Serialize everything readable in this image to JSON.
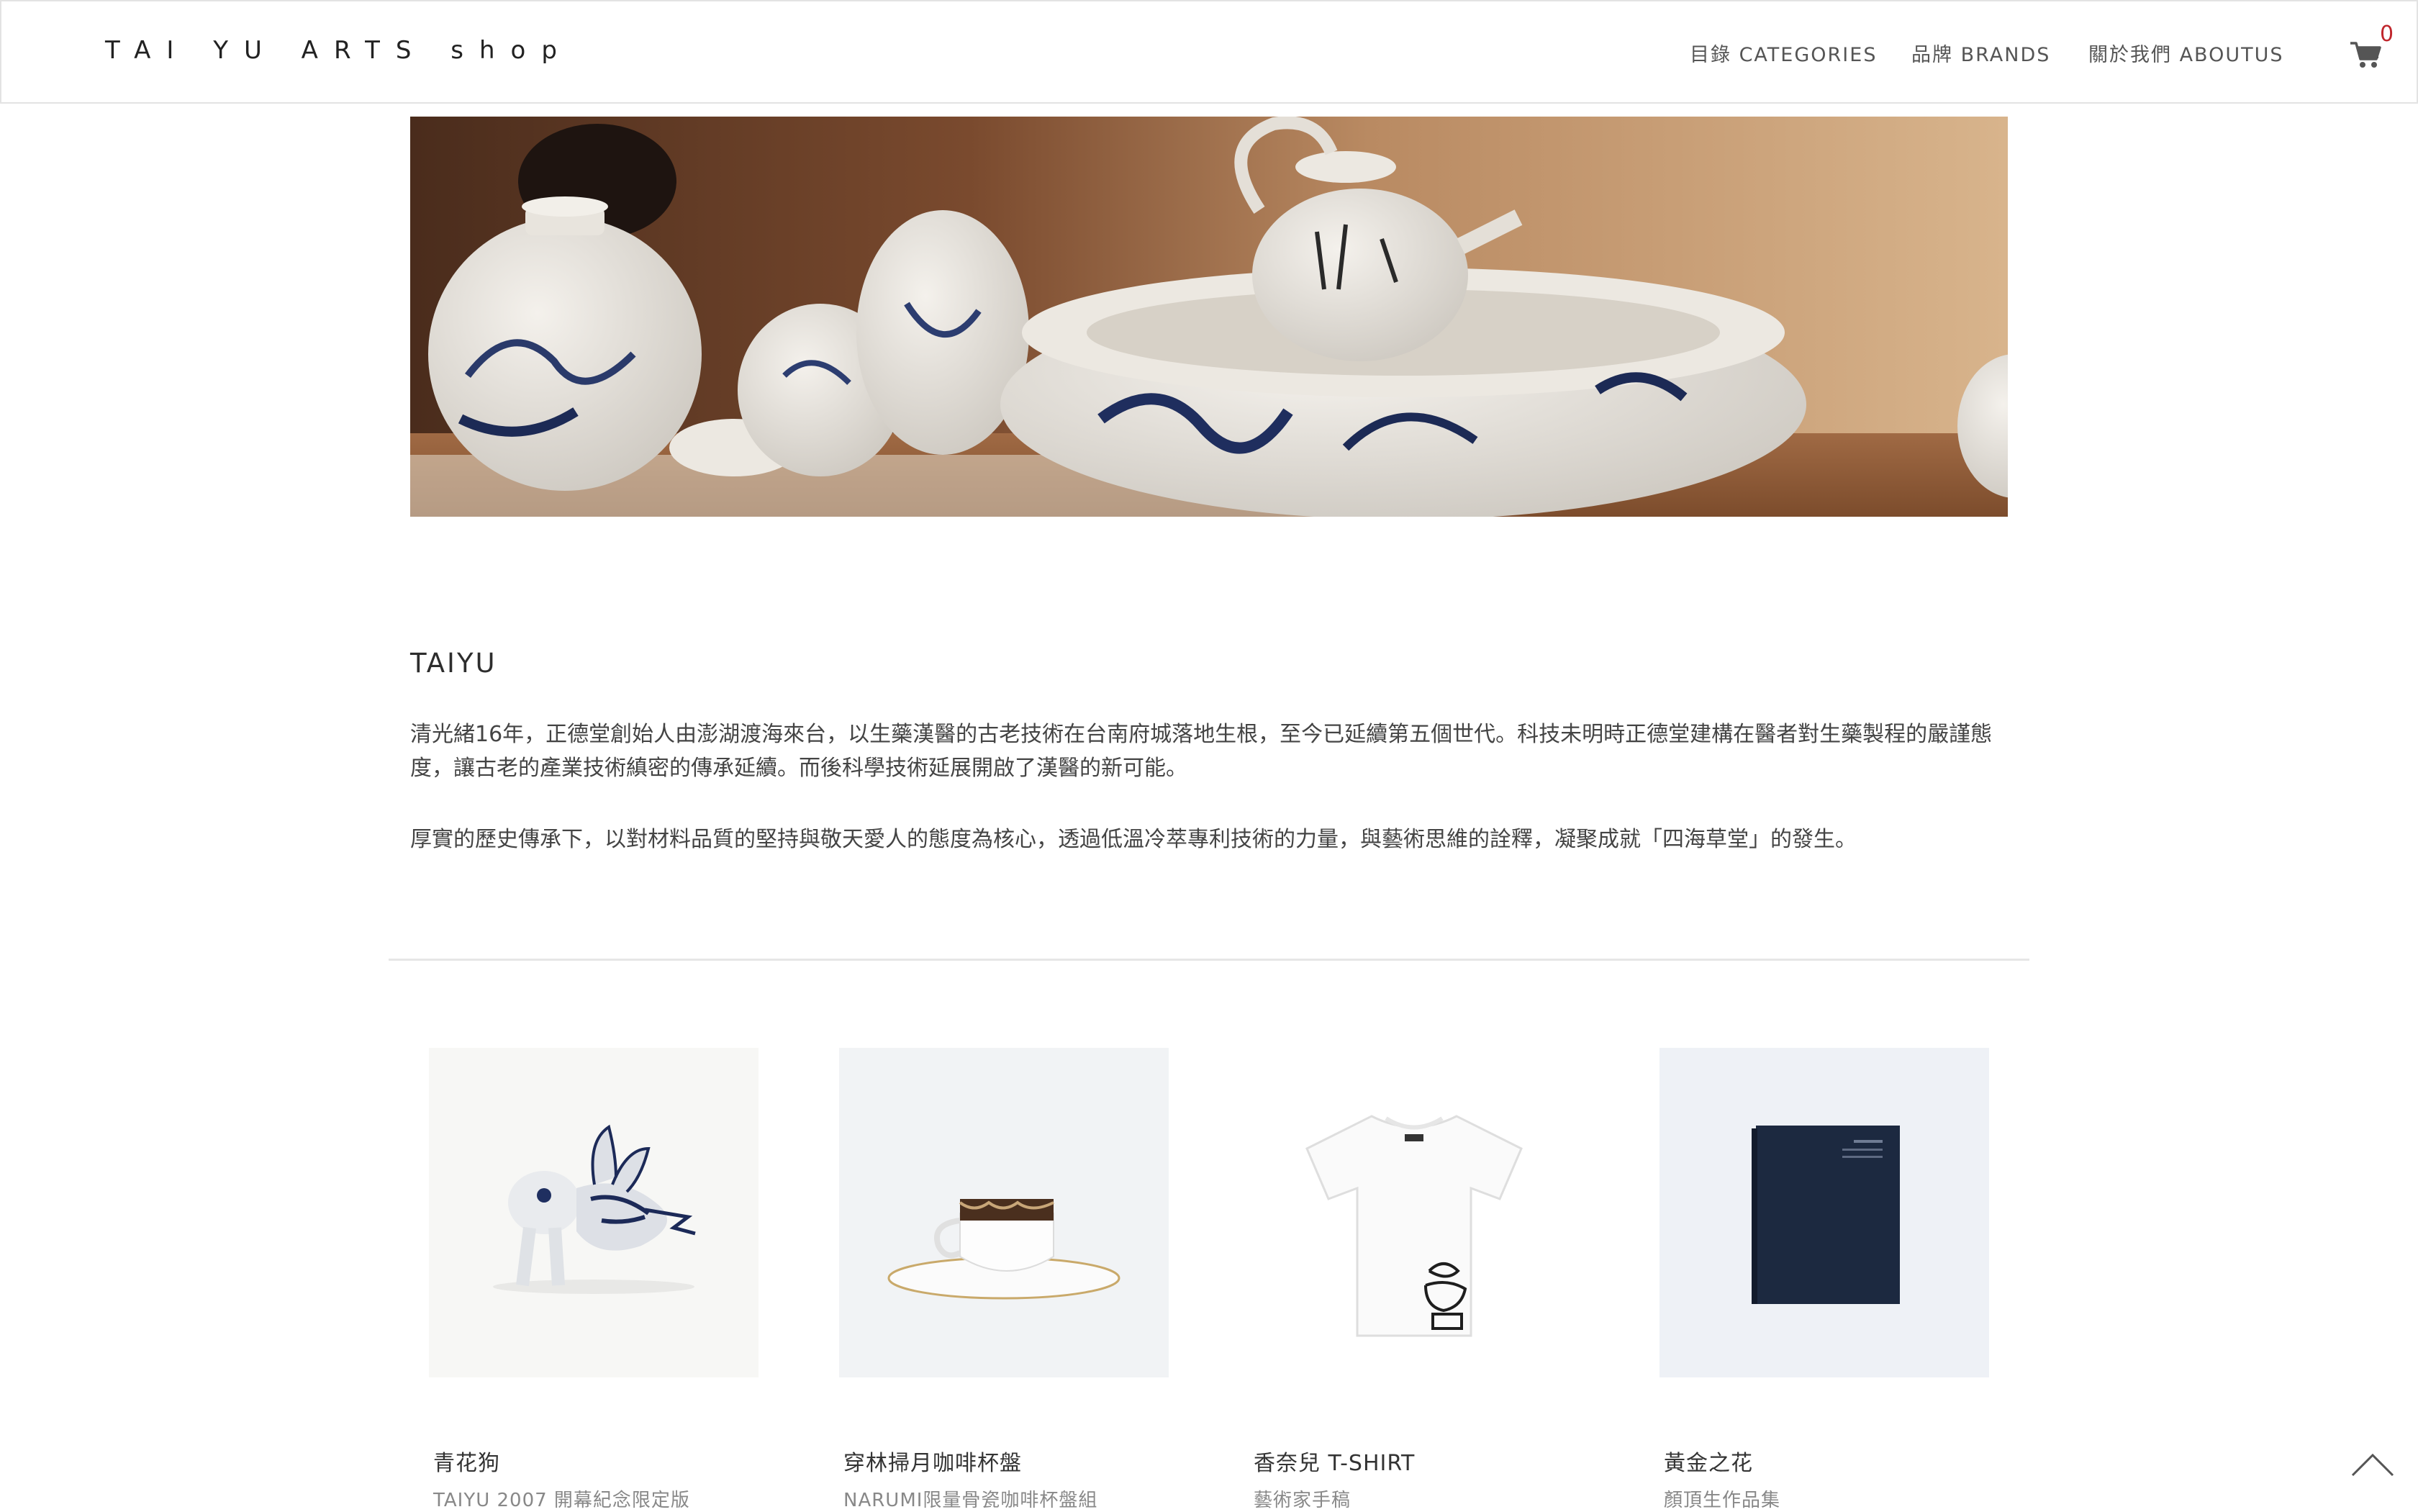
{
  "header": {
    "logo": "TAI YU ARTS shop",
    "nav": [
      {
        "label": "目錄 CATEGORIES"
      },
      {
        "label": "品牌 BRANDS"
      },
      {
        "label": "關於我們 ABOUTUS"
      }
    ],
    "cart_count": "0",
    "cart_icon": "cart-icon"
  },
  "hero": {
    "image": "blue-and-white porcelain tea set (jar, cups, teapot on bowl)"
  },
  "brand": {
    "title": "TAIYU",
    "paragraphs": [
      "清光緒16年，正德堂創始人由澎湖渡海來台，以生藥漢醫的古老技術在台南府城落地生根，至今已延續第五個世代。科技未明時正德堂建構在醫者對生藥製程的嚴謹態度，讓古老的產業技術縝密的傳承延續。而後科學技術延展開啟了漢醫的新可能。",
      "厚實的歷史傳承下，以對材料品質的堅持與敬天愛人的態度為核心，透過低溫冷萃專利技術的力量，與藝術思維的詮釋，凝聚成就「四海草堂」的發生。"
    ]
  },
  "products": [
    {
      "name": "青花狗",
      "sub": "TAIYU 2007 開幕紀念限定版",
      "image": "blue-white porcelain dog figurine"
    },
    {
      "name": "穿林掃月咖啡杯盤",
      "sub": "NARUMI限量骨瓷咖啡杯盤組",
      "image": "coffee cup and saucer"
    },
    {
      "name": "香奈兒 T-SHIRT",
      "sub": "藝術家手稿",
      "image": "white t-shirt with ink drawing"
    },
    {
      "name": "黃金之花",
      "sub": "顏頂生作品集",
      "image": "navy book cover"
    }
  ],
  "back_to_top_icon": "chevron-up-icon"
}
